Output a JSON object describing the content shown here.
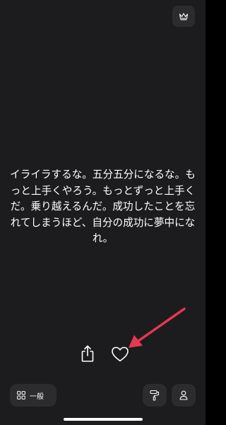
{
  "quote": {
    "text": "イライラするな。五分五分になるな。もっと上手くやろう。もっとずっと上手くだ。乗り越えるんだ。成功したことを忘れてしまうほど、自分の成功に夢中になれ。"
  },
  "toolbar": {
    "premium_icon": "crown-icon",
    "share_icon": "share-icon",
    "like_icon": "heart-icon"
  },
  "bottom_bar": {
    "category_label": "一般",
    "category_icon": "grid-icon",
    "themes_icon": "paint-roller-icon",
    "profile_icon": "person-icon"
  },
  "annotation": {
    "arrow_color": "#e8384f"
  },
  "colors": {
    "background": "#1c1c1e",
    "button_bg": "#2c2c2e",
    "text": "#ffffff"
  }
}
